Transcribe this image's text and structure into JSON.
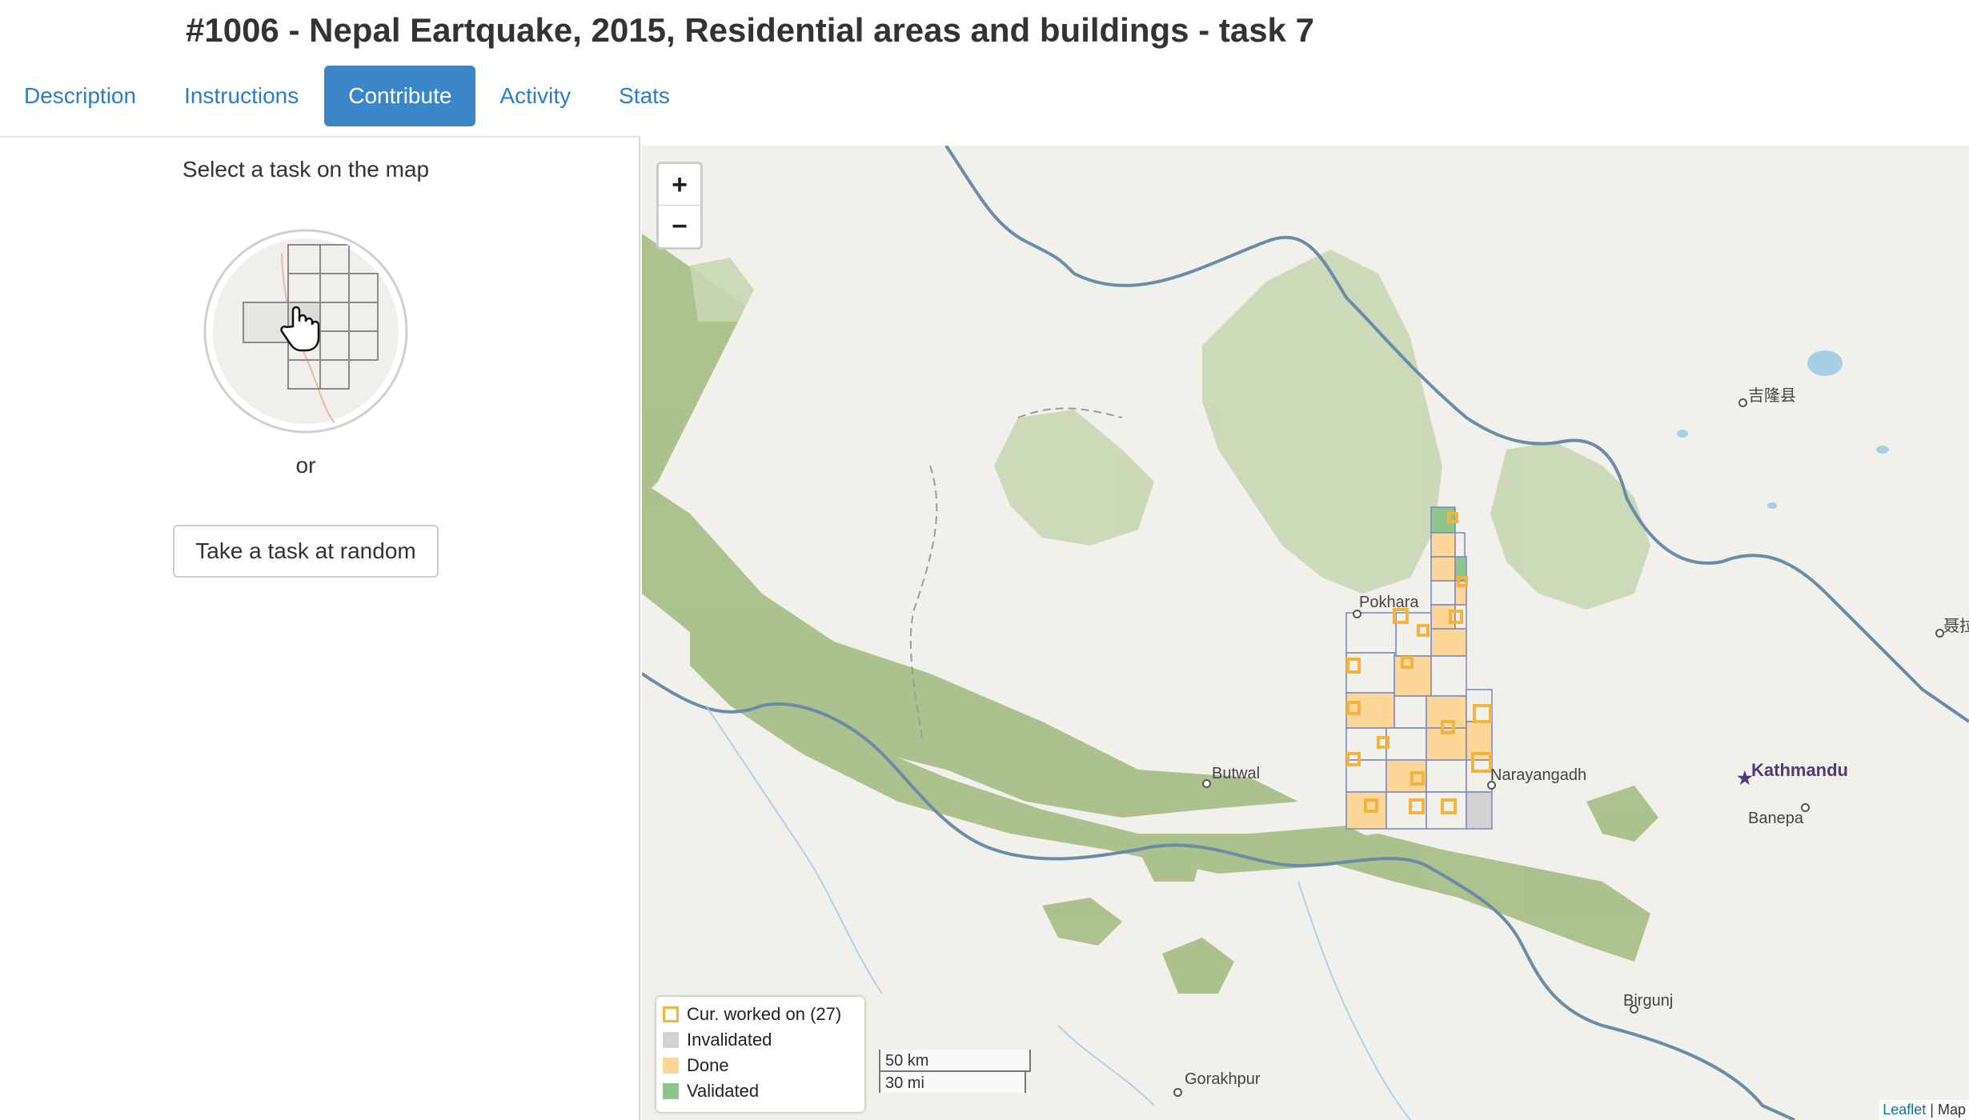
{
  "header": {
    "title": "#1006 - Nepal Eartquake, 2015, Residential areas and buildings - task 7"
  },
  "tabs": [
    {
      "label": "Description",
      "active": false
    },
    {
      "label": "Instructions",
      "active": false
    },
    {
      "label": "Contribute",
      "active": true
    },
    {
      "label": "Activity",
      "active": false
    },
    {
      "label": "Stats",
      "active": false
    }
  ],
  "left_panel": {
    "select_message": "Select a task on the map",
    "or_text": "or",
    "random_button_label": "Take a task at random"
  },
  "map": {
    "zoom_in_label": "+",
    "zoom_out_label": "−",
    "places": {
      "pokhara": "Pokhara",
      "narayangadh": "Narayangadh",
      "butwal": "Butwal",
      "kathmandu": "Kathmandu",
      "banepa": "Banepa",
      "birgunj": "Birgunj",
      "gorakhpur": "Gorakhpur",
      "jilong": "吉隆县",
      "nyalam": "聂拉"
    },
    "scale": {
      "metric": "50 km",
      "imperial": "30 mi"
    },
    "attribution": {
      "leaflet": "Leaflet",
      "rest": "| Map"
    },
    "legend": [
      {
        "label": "Cur. worked on (27)",
        "fill": "#ffffff",
        "border": "#f3b43d"
      },
      {
        "label": "Invalidated",
        "fill": "#d2d2d2",
        "border": "#d2d2d2"
      },
      {
        "label": "Done",
        "fill": "#fcd797",
        "border": "#fcd797"
      },
      {
        "label": "Validated",
        "fill": "#8dc58c",
        "border": "#8dc58c"
      }
    ]
  },
  "colors": {
    "accent": "#3a86c8",
    "link": "#2a7ec4",
    "forest": "#a8c08a",
    "border_line": "#6b8ca8",
    "grid_outline": "#7b86c4"
  }
}
